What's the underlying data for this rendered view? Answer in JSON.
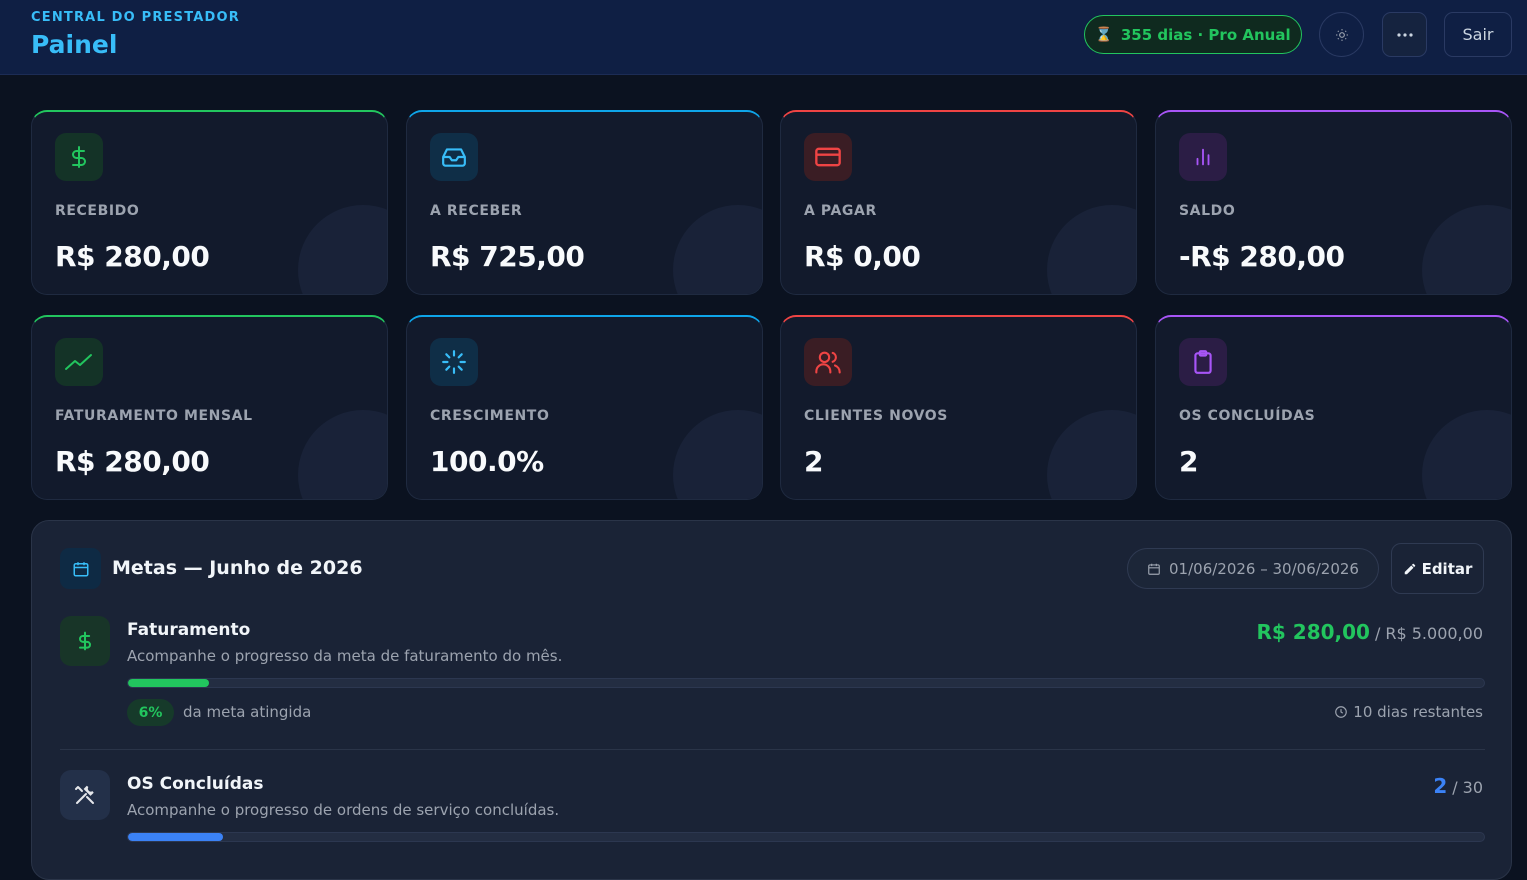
{
  "header": {
    "subtitle": "CENTRAL DO PRESTADOR",
    "title": "Painel",
    "plan_badge": "355 dias · Pro Anual",
    "plan_icon": "hourglass-icon",
    "theme_icon": "sun-icon",
    "more_label": "···",
    "logout_label": "Sair"
  },
  "cards": [
    {
      "label": "RECEBIDO",
      "value": "R$ 280,00",
      "icon": "dollar-icon",
      "accent": "#22c55e"
    },
    {
      "label": "A RECEBER",
      "value": "R$ 725,00",
      "icon": "inbox-icon",
      "accent": "#0ea5e9"
    },
    {
      "label": "A PAGAR",
      "value": "R$ 0,00",
      "icon": "credit-card-icon",
      "accent": "#ef4444"
    },
    {
      "label": "SALDO",
      "value": "-R$ 280,00",
      "icon": "bar-chart-icon",
      "accent": "#a855f7"
    },
    {
      "label": "FATURAMENTO MENSAL",
      "value": "R$ 280,00",
      "icon": "trending-up-icon",
      "accent": "#22c55e"
    },
    {
      "label": "CRESCIMENTO",
      "value": "100.0%",
      "icon": "loader-icon",
      "accent": "#0ea5e9"
    },
    {
      "label": "CLIENTES NOVOS",
      "value": "2",
      "icon": "users-icon",
      "accent": "#ef4444"
    },
    {
      "label": "OS CONCLUÍDAS",
      "value": "2",
      "icon": "clipboard-icon",
      "accent": "#a855f7"
    }
  ],
  "goals": {
    "title": "Metas — Junho de 2026",
    "period": "01/06/2026 – 30/06/2026",
    "edit_label": "Editar",
    "items": [
      {
        "name": "Faturamento",
        "description": "Acompanhe o progresso da meta de faturamento do mês.",
        "current": "R$ 280,00",
        "separator": "/",
        "target": "R$ 5.000,00",
        "progress": 0.06,
        "percent_label": "6%",
        "percent_text": "da meta atingida",
        "days_left": "10 dias restantes",
        "color": "#22c55e",
        "icon": "dollar-icon"
      },
      {
        "name": "OS Concluídas",
        "description": "Acompanhe o progresso de ordens de serviço concluídas.",
        "current": "2",
        "separator": "/",
        "target": "30",
        "progress": 0.07,
        "color": "#3b82f6",
        "icon": "tools-icon"
      }
    ]
  }
}
